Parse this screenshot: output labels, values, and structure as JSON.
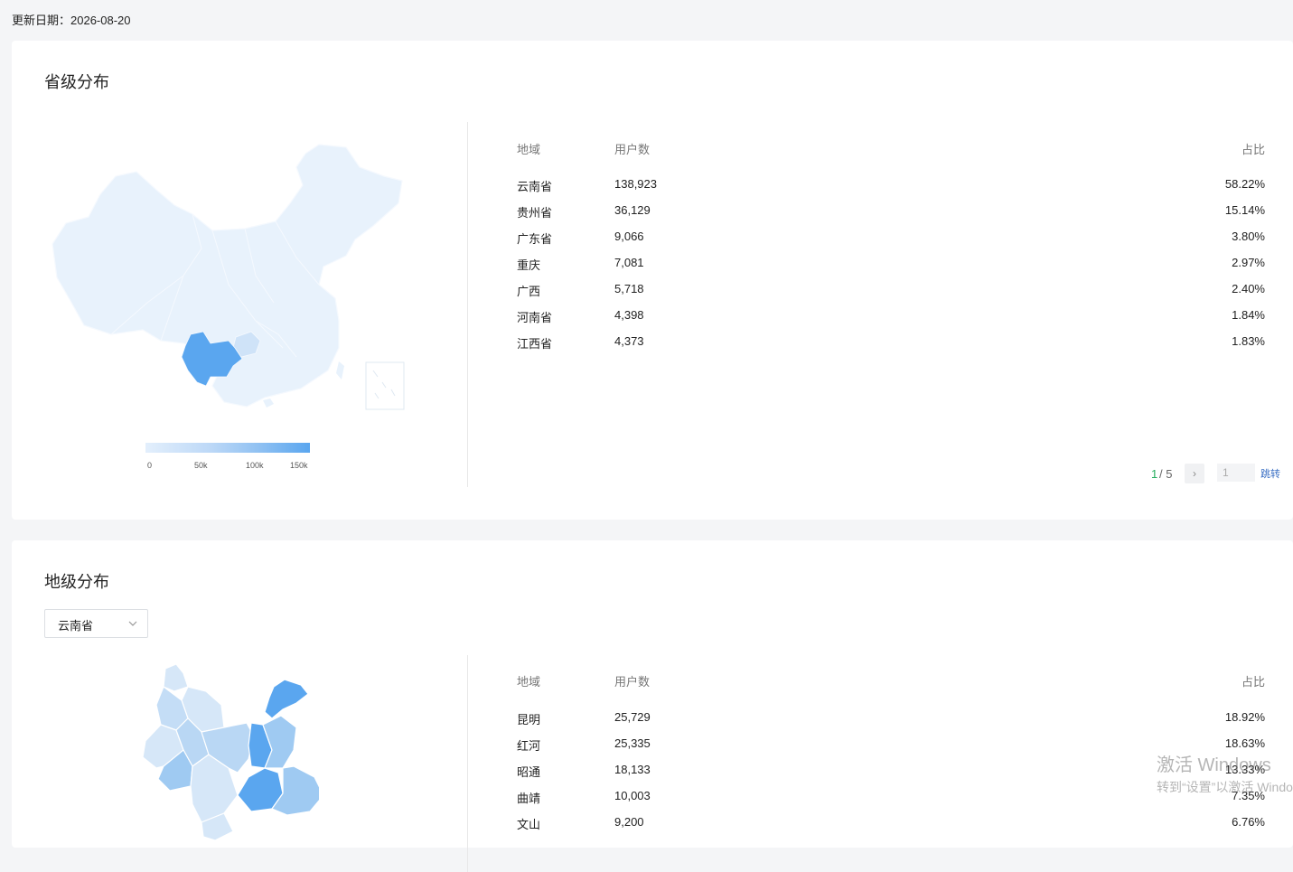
{
  "header": {
    "update_label": "更新日期：",
    "update_date": "2026-08-20"
  },
  "province_section": {
    "title": "省级分布",
    "table": {
      "headers": {
        "region": "地域",
        "users": "用户数",
        "ratio": "占比"
      },
      "rows": [
        {
          "region": "云南省",
          "users": "138,923",
          "ratio": "58.22%"
        },
        {
          "region": "贵州省",
          "users": "36,129",
          "ratio": "15.14%"
        },
        {
          "region": "广东省",
          "users": "9,066",
          "ratio": "3.80%"
        },
        {
          "region": "重庆",
          "users": "7,081",
          "ratio": "2.97%"
        },
        {
          "region": "广西",
          "users": "5,718",
          "ratio": "2.40%"
        },
        {
          "region": "河南省",
          "users": "4,398",
          "ratio": "1.84%"
        },
        {
          "region": "江西省",
          "users": "4,373",
          "ratio": "1.83%"
        }
      ]
    },
    "legend": {
      "ticks": [
        "0",
        "50k",
        "100k",
        "150k"
      ]
    },
    "pagination": {
      "current": "1",
      "separator": " / 5",
      "input_value": "1",
      "jump_label": "跳转"
    }
  },
  "city_section": {
    "title": "地级分布",
    "select_value": "云南省",
    "table": {
      "headers": {
        "region": "地域",
        "users": "用户数",
        "ratio": "占比"
      },
      "rows": [
        {
          "region": "昆明",
          "users": "25,729",
          "ratio": "18.92%"
        },
        {
          "region": "红河",
          "users": "25,335",
          "ratio": "18.63%"
        },
        {
          "region": "昭通",
          "users": "18,133",
          "ratio": "13.33%"
        },
        {
          "region": "曲靖",
          "users": "10,003",
          "ratio": "7.35%"
        },
        {
          "region": "文山",
          "users": "9,200",
          "ratio": "6.76%"
        }
      ]
    }
  },
  "watermark": {
    "line1": "激活 Windows",
    "line2": "转到“设置”以激活 Windows。"
  },
  "colors": {
    "map_base": "#e8f2fc",
    "map_highlight": "#5aa6ef",
    "map_mid": "#cfe3f8",
    "accent_green": "#27ae60"
  }
}
